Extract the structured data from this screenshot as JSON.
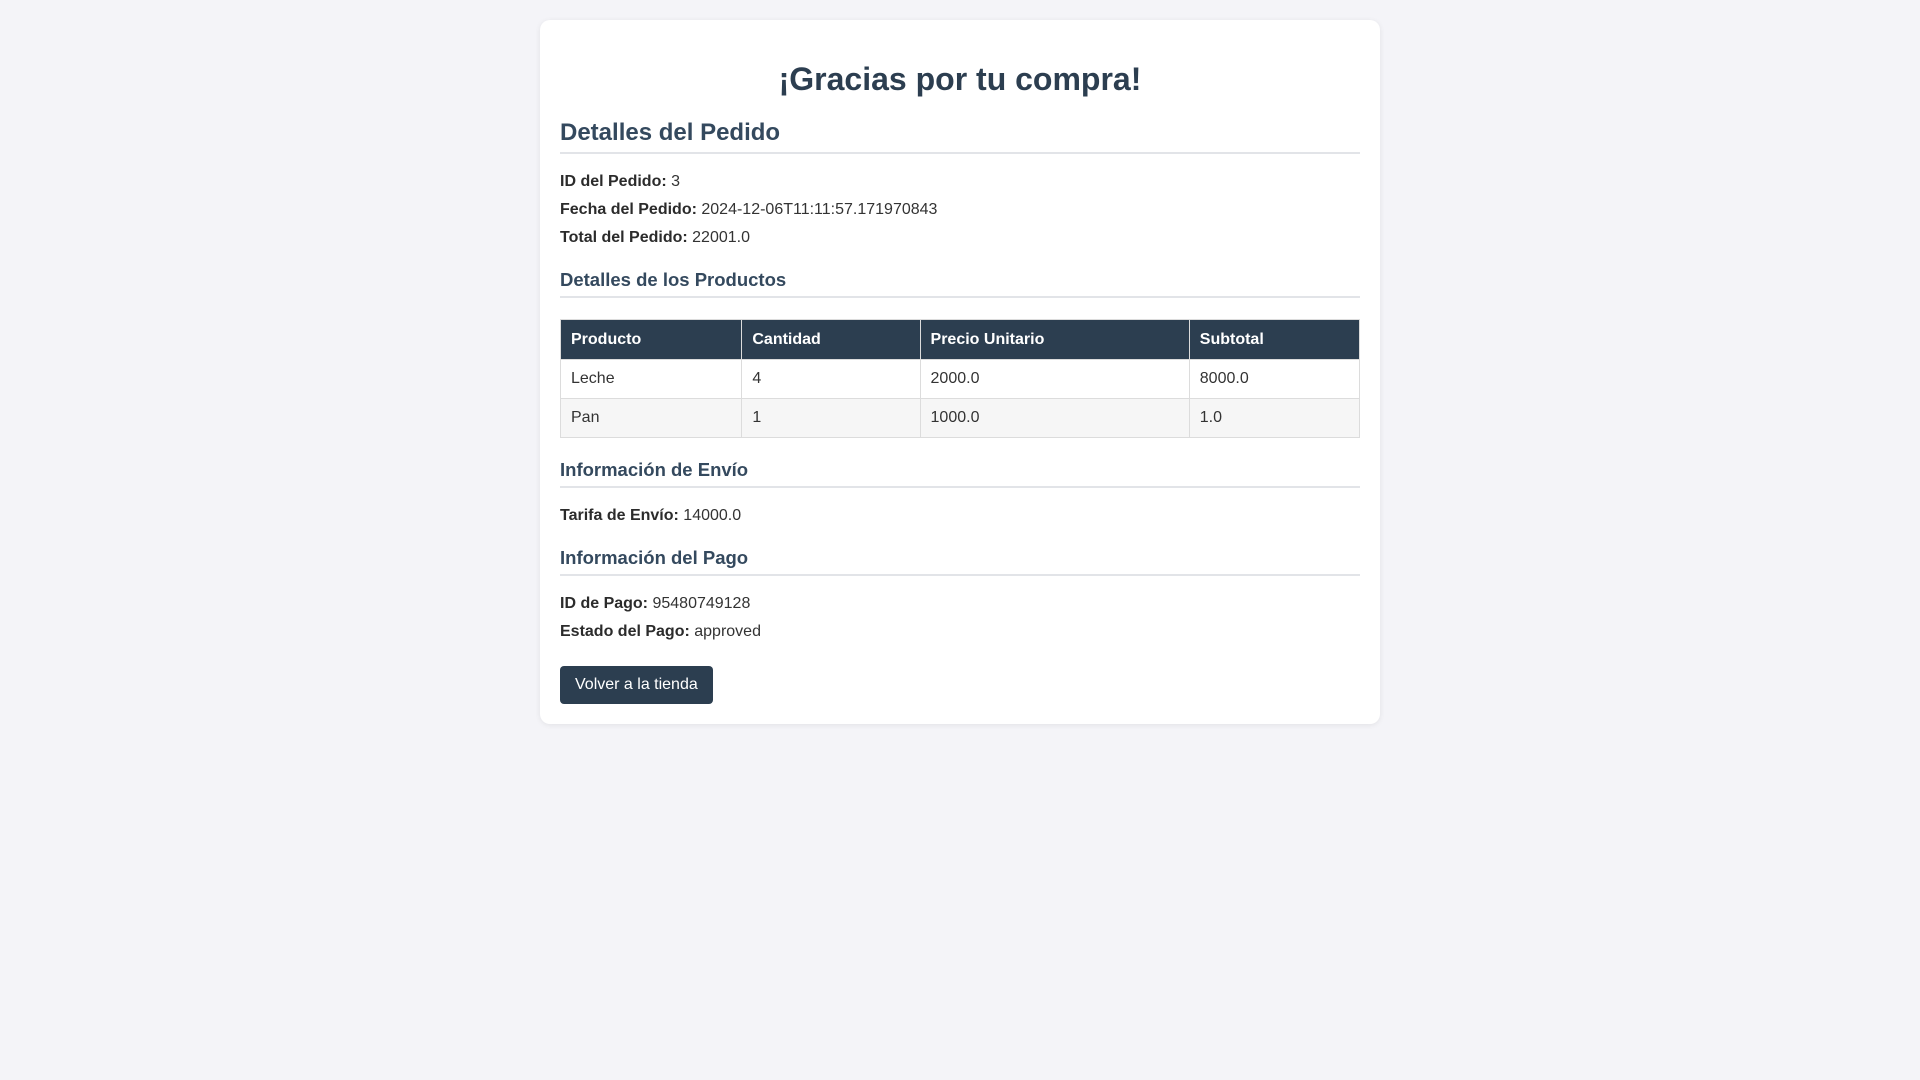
{
  "page": {
    "title": "¡Gracias por tu compra!"
  },
  "order": {
    "heading": "Detalles del Pedido",
    "id_label": "ID del Pedido:",
    "id_value": "3",
    "date_label": "Fecha del Pedido:",
    "date_value": "2024-12-06T11:11:57.171970843",
    "total_label": "Total del Pedido:",
    "total_value": "22001.0"
  },
  "products": {
    "heading": "Detalles de los Productos",
    "columns": [
      "Producto",
      "Cantidad",
      "Precio Unitario",
      "Subtotal"
    ],
    "rows": [
      [
        "Leche",
        "4",
        "2000.0",
        "8000.0"
      ],
      [
        "Pan",
        "1",
        "1000.0",
        "1.0"
      ]
    ]
  },
  "shipping": {
    "heading": "Información de Envío",
    "fee_label": "Tarifa de Envío:",
    "fee_value": "14000.0"
  },
  "payment": {
    "heading": "Información del Pago",
    "id_label": "ID de Pago:",
    "id_value": "95480749128",
    "status_label": "Estado del Pago:",
    "status_value": "approved"
  },
  "actions": {
    "back_label": "Volver a la tienda"
  },
  "colors": {
    "accent": "#2c3e50",
    "background": "#f4f4f8"
  }
}
